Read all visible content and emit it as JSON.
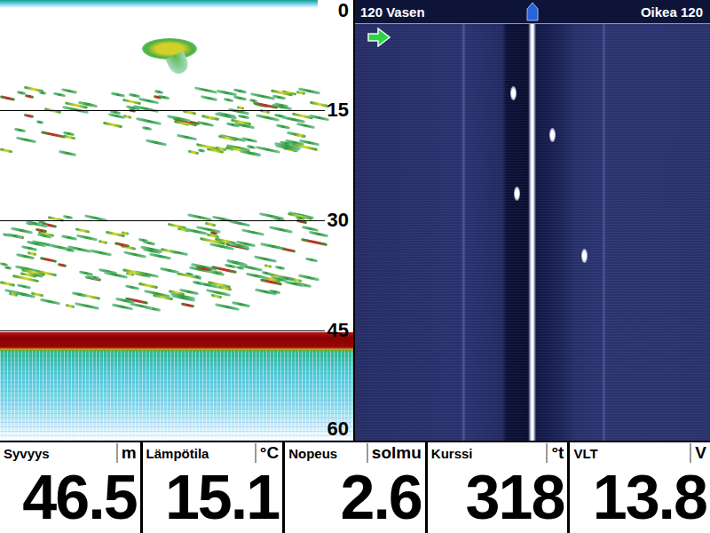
{
  "sonar": {
    "scale_max": 60,
    "ticks": [
      "0",
      "15",
      "30",
      "45",
      "60"
    ],
    "bottom_depth": 45.3,
    "bottom_band": 2.5,
    "layers": [
      {
        "from": 12,
        "to": 21
      },
      {
        "from": 29,
        "to": 42
      }
    ],
    "fish": [
      {
        "depth": 6.6,
        "x": 0.48
      }
    ]
  },
  "side_imaging": {
    "left_label": "120 Vasen",
    "right_label": "Oikea 120",
    "range": 120,
    "targets": [
      {
        "side": "left",
        "range": 13,
        "time": 0.15
      },
      {
        "side": "left",
        "range": 11,
        "time": 0.39
      },
      {
        "side": "right",
        "range": 13,
        "time": 0.25
      },
      {
        "side": "right",
        "range": 35,
        "time": 0.54
      }
    ]
  },
  "readouts": [
    {
      "label": "Syvyys",
      "unit": "m",
      "value": "46.5"
    },
    {
      "label": "Lämpötila",
      "unit": "°C",
      "value": "15.1"
    },
    {
      "label": "Nopeus",
      "unit": "solmu",
      "value": "2.6"
    },
    {
      "label": "Kurssi",
      "unit": "°t",
      "value": "318"
    },
    {
      "label": "VLT",
      "unit": "V",
      "value": "13.8"
    }
  ]
}
